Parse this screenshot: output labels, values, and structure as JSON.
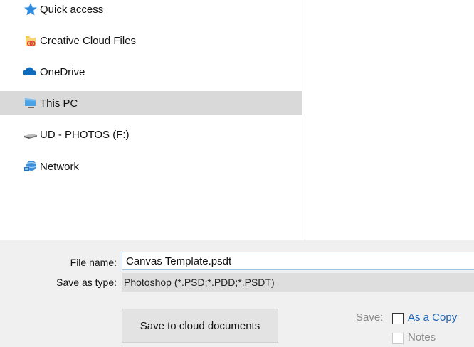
{
  "navigation": {
    "items": [
      {
        "label": "Quick access",
        "icon": "star-icon",
        "selected": false
      },
      {
        "label": "Creative Cloud Files",
        "icon": "creative-cloud-folder-icon",
        "selected": false
      },
      {
        "label": "OneDrive",
        "icon": "onedrive-cloud-icon",
        "selected": false
      },
      {
        "label": "This PC",
        "icon": "computer-icon",
        "selected": true
      },
      {
        "label": "UD - PHOTOS (F:)",
        "icon": "drive-icon",
        "selected": false
      },
      {
        "label": "Network",
        "icon": "network-icon",
        "selected": false
      }
    ]
  },
  "form": {
    "file_name_label": "File name:",
    "file_name_value": "Canvas Template.psdt",
    "save_type_label": "Save as type:",
    "save_type_value": "Photoshop (*.PSD;*.PDD;*.PSDT)"
  },
  "actions": {
    "cloud_button_label": "Save to cloud documents",
    "save_label": "Save:",
    "as_copy_label": "As a Copy",
    "notes_label": "Notes"
  },
  "colors": {
    "selection": "#d9d9d9",
    "link_blue": "#1a64b8",
    "panel_bg": "#f0f0f0"
  }
}
